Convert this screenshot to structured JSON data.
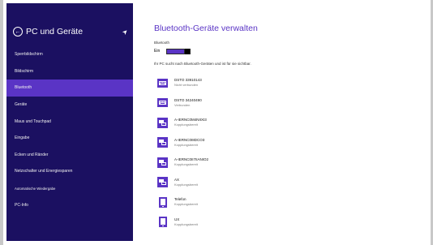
{
  "sidebar": {
    "title": "PC und Geräte",
    "items": [
      {
        "label": "Sperrbildschirm",
        "selected": false,
        "size": "normal"
      },
      {
        "label": "Bildschirm",
        "selected": false,
        "size": "normal"
      },
      {
        "label": "Bluetooth",
        "selected": true,
        "size": "normal"
      },
      {
        "label": "Geräte",
        "selected": false,
        "size": "normal"
      },
      {
        "label": "Maus und Touchpad",
        "selected": false,
        "size": "normal"
      },
      {
        "label": "Eingabe",
        "selected": false,
        "size": "normal"
      },
      {
        "label": "Ecken und Ränder",
        "selected": false,
        "size": "normal"
      },
      {
        "label": "Netzschalter und Energiesparen",
        "selected": false,
        "size": "normal"
      },
      {
        "label": "Automatische Wiedergabe",
        "selected": false,
        "size": "small"
      },
      {
        "label": "PC-Info",
        "selected": false,
        "size": "normal"
      }
    ]
  },
  "main": {
    "title": "Bluetooth-Geräte verwalten",
    "bluetooth_label": "Bluetooth",
    "bluetooth_state": "Ein",
    "search_note": "Ihr PC sucht nach Bluetooth-Geräten und ist für sie sichtbar.",
    "devices": [
      {
        "name": "DSTO 33910143",
        "status": "Nicht verbunden",
        "icon": "keyboard-icon"
      },
      {
        "name": "DSTO 34240490",
        "status": "Verbunden",
        "icon": "keyboard-icon"
      },
      {
        "name": "A-IERNC0M4NIIXI3",
        "status": "Kopplungsbereit",
        "icon": "computer-icon"
      },
      {
        "name": "A-IERNC0I8DCO3",
        "status": "Kopplungsbereit",
        "icon": "computer-icon"
      },
      {
        "name": "A-IERNC0II7IIANIO2",
        "status": "Kopplungsbereit",
        "icon": "computer-icon"
      },
      {
        "name": "AX",
        "status": "Kopplungsbereit",
        "icon": "computer-icon"
      },
      {
        "name": "Telefon",
        "status": "Kopplungsbereit",
        "icon": "phone-icon"
      },
      {
        "name": "UX",
        "status": "Kopplungsbereit",
        "icon": "phone-icon"
      }
    ]
  },
  "colors": {
    "sidebar_bg": "#1b1061",
    "accent": "#5a34c5"
  }
}
